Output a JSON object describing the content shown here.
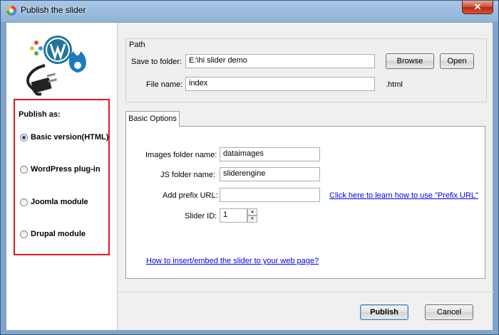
{
  "window": {
    "title": "Publish the slider",
    "close_label": "✕"
  },
  "sidebar": {
    "publish_as_label": "Publish as:",
    "options": [
      {
        "label": "Basic version(HTML)",
        "checked": true
      },
      {
        "label": "WordPress plug-in",
        "checked": false
      },
      {
        "label": "Joomla module",
        "checked": false
      },
      {
        "label": "Drupal module",
        "checked": false
      }
    ]
  },
  "path": {
    "group_title": "Path",
    "save_label": "Save to folder:",
    "save_value": "E:\\hi slider demo",
    "file_label": "File name:",
    "file_value": "index",
    "file_ext": ".html",
    "browse_label": "Browse",
    "open_label": "Open"
  },
  "basic_options": {
    "tab_label": "Basic Options",
    "images_label": "Images folder name:",
    "images_value": "dataimages",
    "js_label": "JS folder name:",
    "js_value": "sliderengine",
    "prefix_label": "Add prefix URL:",
    "prefix_value": "",
    "prefix_help_link": "Click here to learn how to use \"Prefix URL\"",
    "slider_id_label": "Slider ID:",
    "slider_id_value": "1",
    "embed_link": "How to insert/embed the slider to your web page?"
  },
  "footer": {
    "publish_label": "Publish",
    "cancel_label": "Cancel"
  },
  "colors": {
    "highlight_box": "#e0191f",
    "link": "#0000ee",
    "title_bar": "#8fb2d8"
  }
}
